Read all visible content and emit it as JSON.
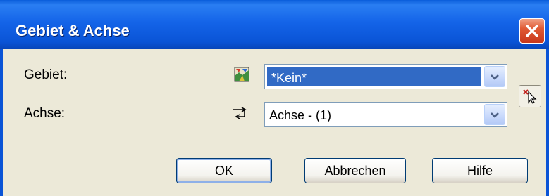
{
  "window": {
    "title": "Gebiet & Achse"
  },
  "fields": {
    "gebiet": {
      "label": "Gebiet:",
      "value": "*Kein*"
    },
    "achse": {
      "label": "Achse:",
      "value": "Achse - (1)"
    }
  },
  "buttons": {
    "ok": "OK",
    "cancel": "Abbrechen",
    "help": "Hilfe"
  },
  "icons": {
    "close": "close-icon",
    "gebiet": "area-map-icon",
    "achse": "axis-arrows-icon",
    "dropdown": "chevron-down-icon",
    "picker": "pick-cursor-icon"
  },
  "colors": {
    "titlebar": "#0a54d6",
    "selection": "#316ac5",
    "close": "#e05a34",
    "face": "#ece9d8"
  }
}
